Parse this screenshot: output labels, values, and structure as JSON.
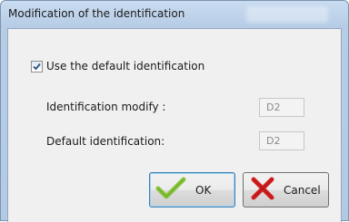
{
  "window": {
    "title": "Modification of the identification"
  },
  "form": {
    "use_default_checkbox": {
      "label": "Use the default identification",
      "checked": true
    },
    "identification_modify": {
      "label": "Identification modify :",
      "value": "D2"
    },
    "default_identification": {
      "label": "Default identification:",
      "value": "D2"
    }
  },
  "buttons": {
    "ok_label": "OK",
    "cancel_label": "Cancel",
    "ok_icon": "green-checkmark-icon",
    "cancel_icon": "red-x-icon"
  },
  "colors": {
    "title_bar": "#b7cde6",
    "ok_check": "#8cc63f",
    "cancel_x": "#d42020"
  }
}
